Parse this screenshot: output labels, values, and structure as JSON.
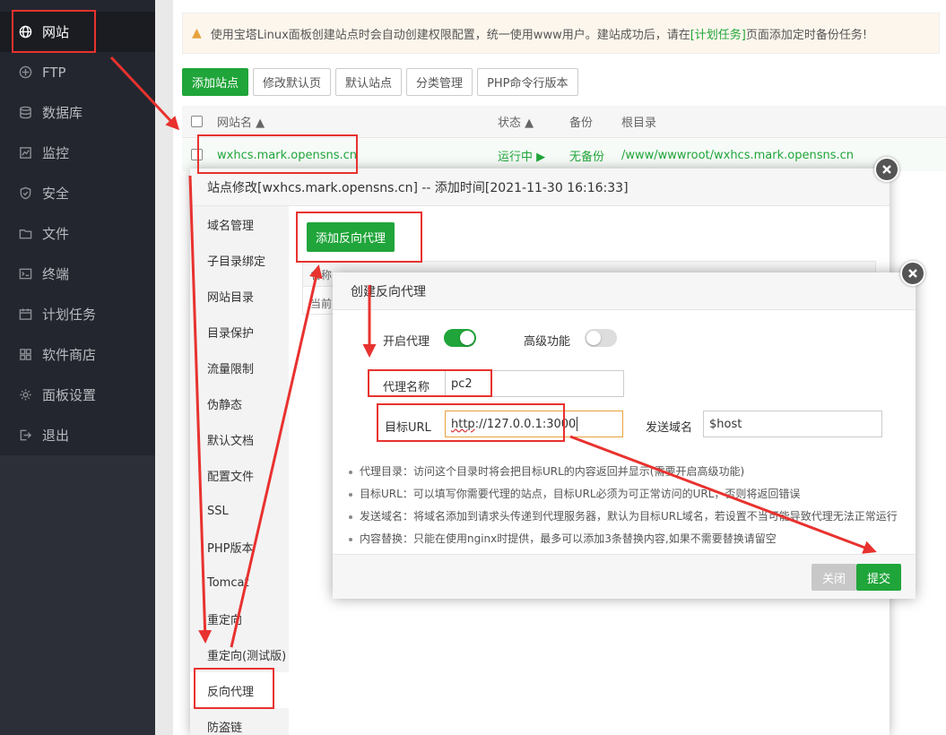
{
  "sidebar": {
    "items": [
      {
        "label": "网站",
        "icon": "globe-icon"
      },
      {
        "label": "FTP",
        "icon": "ftp-icon"
      },
      {
        "label": "数据库",
        "icon": "database-icon"
      },
      {
        "label": "监控",
        "icon": "monitor-icon"
      },
      {
        "label": "安全",
        "icon": "shield-icon"
      },
      {
        "label": "文件",
        "icon": "folder-icon"
      },
      {
        "label": "终端",
        "icon": "terminal-icon"
      },
      {
        "label": "计划任务",
        "icon": "calendar-icon"
      },
      {
        "label": "软件商店",
        "icon": "grid-icon"
      },
      {
        "label": "面板设置",
        "icon": "gear-icon"
      },
      {
        "label": "退出",
        "icon": "logout-icon"
      }
    ]
  },
  "notice": {
    "text_before": "使用宝塔Linux面板创建站点时会自动创建权限配置，统一使用www用户。建站成功后，请在",
    "link": "[计划任务]",
    "text_after": "页面添加定时备份任务!"
  },
  "toolbar": {
    "add_site": "添加站点",
    "modify_default_page": "修改默认页",
    "default_site": "默认站点",
    "category_manage": "分类管理",
    "php_cli_version": "PHP命令行版本"
  },
  "table": {
    "headers": {
      "name": "网站名 ▲",
      "status": "状态 ▲",
      "backup": "备份",
      "root": "根目录"
    },
    "row": {
      "name": "wxhcs.mark.opensns.cn",
      "status": "运行中 ▶",
      "backup": "无备份",
      "root": "/www/wwwroot/wxhcs.mark.opensns.cn"
    }
  },
  "site_dialog": {
    "title": "站点修改[wxhcs.mark.opensns.cn] -- 添加时间[2021-11-30 16:16:33]",
    "menu": [
      "域名管理",
      "子目录绑定",
      "网站目录",
      "目录保护",
      "流量限制",
      "伪静态",
      "默认文档",
      "配置文件",
      "SSL",
      "PHP版本",
      "Tomcat",
      "重定向",
      "重定向(测试版)",
      "反向代理",
      "防盗链"
    ],
    "add_proxy_button": "添加反向代理",
    "inner_head_partial": "名称",
    "inner_row_partial": "当前"
  },
  "proxy_dialog": {
    "title": "创建反向代理",
    "enable_proxy_label": "开启代理",
    "enable_proxy_on": true,
    "advanced_label": "高级功能",
    "advanced_on": false,
    "proxy_name_label": "代理名称",
    "proxy_name_value": "pc2",
    "target_url_label": "目标URL",
    "target_url_value_a": "http",
    "target_url_value_b": "://127.0.0.1:3000",
    "send_domain_label": "发送域名",
    "send_domain_value": "$host",
    "tips": [
      "代理目录：访问这个目录时将会把目标URL的内容返回并显示(需要开启高级功能)",
      "目标URL：可以填写你需要代理的站点，目标URL必须为可正常访问的URL，否则将返回错误",
      "发送域名：将域名添加到请求头传递到代理服务器，默认为目标URL域名，若设置不当可能导致代理无法正常运行",
      "内容替换：只能在使用nginx时提供，最多可以添加3条替换内容,如果不需要替换请留空"
    ],
    "close_button": "关闭",
    "submit_button": "提交"
  },
  "colors": {
    "accent": "#20a53a",
    "annotation": "#e8322f",
    "sidebar_bg": "#23262e"
  }
}
